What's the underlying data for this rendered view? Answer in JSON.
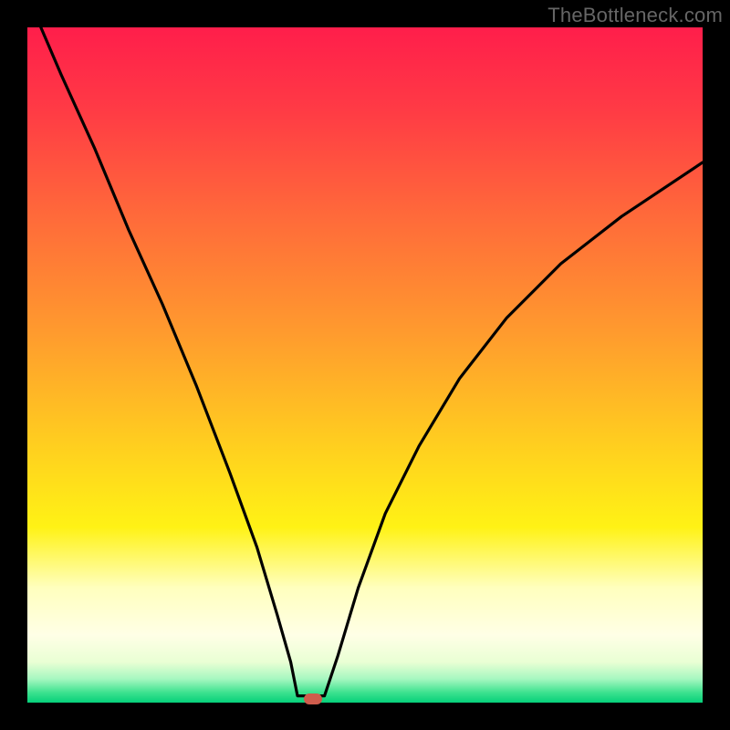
{
  "watermark": "TheBottleneck.com",
  "colors": {
    "frame_bg": "#000000",
    "gradient_stops": [
      {
        "offset": 0.0,
        "color": "#ff1e4b"
      },
      {
        "offset": 0.12,
        "color": "#ff3a45"
      },
      {
        "offset": 0.28,
        "color": "#ff6a3a"
      },
      {
        "offset": 0.45,
        "color": "#ff9a2e"
      },
      {
        "offset": 0.62,
        "color": "#ffcf1f"
      },
      {
        "offset": 0.74,
        "color": "#fff215"
      },
      {
        "offset": 0.83,
        "color": "#ffffbe"
      },
      {
        "offset": 0.9,
        "color": "#ffffe6"
      },
      {
        "offset": 0.94,
        "color": "#e9ffd4"
      },
      {
        "offset": 0.965,
        "color": "#a6f7c0"
      },
      {
        "offset": 0.985,
        "color": "#3de28f"
      },
      {
        "offset": 1.0,
        "color": "#06d07a"
      }
    ],
    "curve_stroke": "#000000",
    "marker_fill": "#cf5c4c"
  },
  "chart_data": {
    "type": "line",
    "title": "",
    "xlabel": "",
    "ylabel": "",
    "xlim": [
      0,
      100
    ],
    "ylim": [
      0,
      100
    ],
    "grid": false,
    "curve": {
      "minimum_x": 42,
      "flat_range": [
        40,
        44
      ],
      "left_branch": [
        {
          "x": 2,
          "y": 100
        },
        {
          "x": 5,
          "y": 93
        },
        {
          "x": 10,
          "y": 82
        },
        {
          "x": 15,
          "y": 70
        },
        {
          "x": 20,
          "y": 59
        },
        {
          "x": 25,
          "y": 47
        },
        {
          "x": 30,
          "y": 34
        },
        {
          "x": 34,
          "y": 23
        },
        {
          "x": 37,
          "y": 13
        },
        {
          "x": 39,
          "y": 6
        },
        {
          "x": 40,
          "y": 1
        }
      ],
      "flat": [
        {
          "x": 40,
          "y": 1
        },
        {
          "x": 44,
          "y": 1
        }
      ],
      "right_branch": [
        {
          "x": 44,
          "y": 1
        },
        {
          "x": 46,
          "y": 7
        },
        {
          "x": 49,
          "y": 17
        },
        {
          "x": 53,
          "y": 28
        },
        {
          "x": 58,
          "y": 38
        },
        {
          "x": 64,
          "y": 48
        },
        {
          "x": 71,
          "y": 57
        },
        {
          "x": 79,
          "y": 65
        },
        {
          "x": 88,
          "y": 72
        },
        {
          "x": 100,
          "y": 80
        }
      ]
    },
    "marker": {
      "x": 42.3,
      "y": 0.6
    }
  }
}
